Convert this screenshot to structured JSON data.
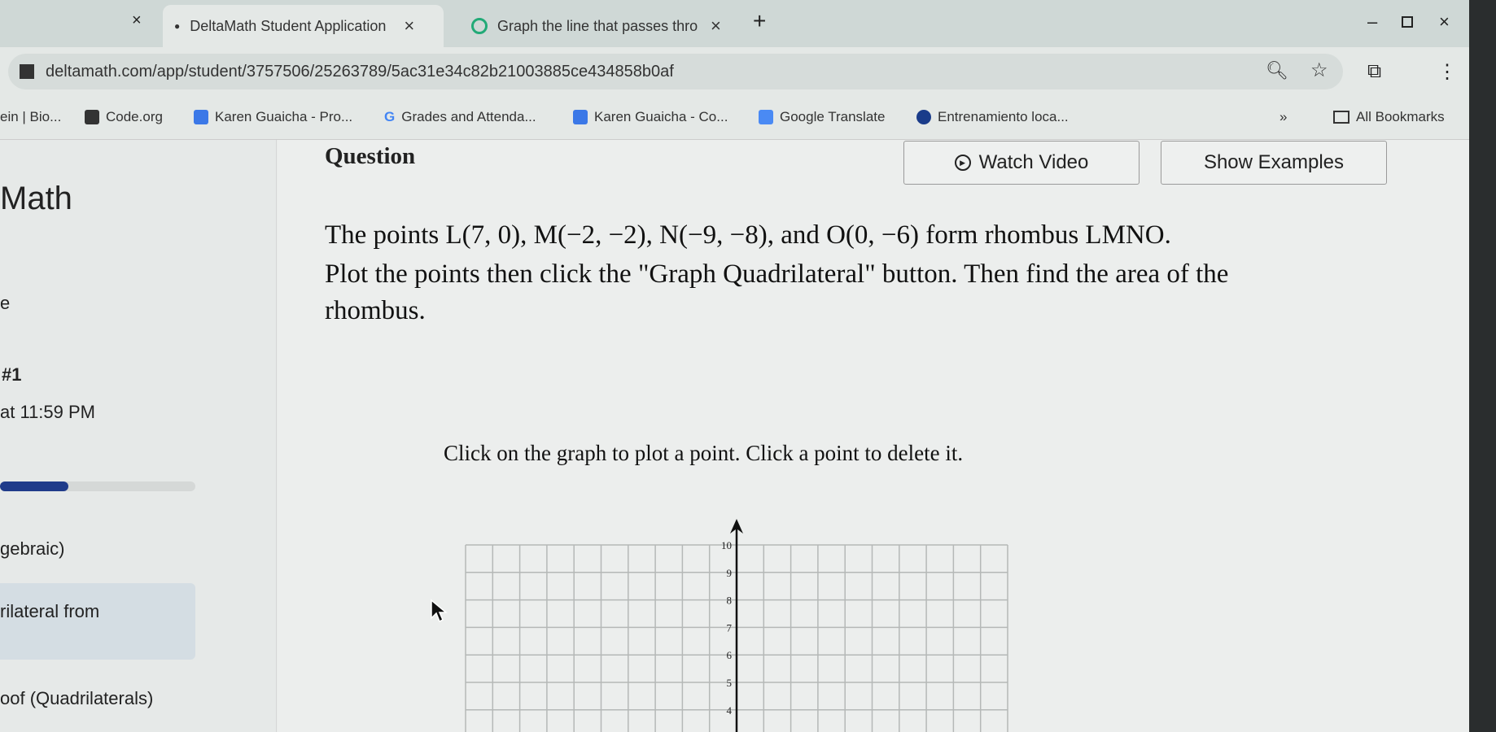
{
  "browser": {
    "tabs": [
      {
        "label": "DeltaMath Student Application",
        "active": true
      },
      {
        "label": "Graph the line that passes thro",
        "active": false
      }
    ],
    "new_tab": "+",
    "close_glyph": "×",
    "url": "deltamath.com/app/student/3757506/25263789/5ac31e34c82b21003885ce434858b0af",
    "bookmarks": [
      "ein | Bio...",
      "Code.org",
      "Karen Guaicha - Pro...",
      "Grades and Attenda...",
      "Karen Guaicha - Co...",
      "Google Translate",
      "Entrenamiento loca..."
    ],
    "more_bookmarks": "»",
    "all_bookmarks": "All Bookmarks"
  },
  "sidebar": {
    "title": "Math",
    "item_e": "e",
    "assignment_number": "#1",
    "due": "at 11:59 PM",
    "progress_percent": 35,
    "items": [
      "gebraic)",
      "rilateral from",
      "oof (Quadrilaterals)"
    ]
  },
  "main": {
    "question_label": "Question",
    "watch_video": "Watch Video",
    "show_examples": "Show Examples",
    "question_lines": [
      "The points L(7, 0), M(−2, −2), N(−9, −8), and O(0, −6) form rhombus LMNO.",
      "Plot the points then click the \"Graph Quadrilateral\" button. Then find the area of the",
      "rhombus."
    ],
    "instruction": "Click on the graph to plot a point. Click a point to delete it.",
    "graph": {
      "x_range": [
        -10,
        10
      ],
      "y_visible_ticks": [
        "10",
        "9",
        "8",
        "7",
        "6",
        "5",
        "4"
      ]
    }
  },
  "colors": {
    "progress": "#1f3b8a",
    "axis": "#111111",
    "grid": "#b5b8b7"
  }
}
